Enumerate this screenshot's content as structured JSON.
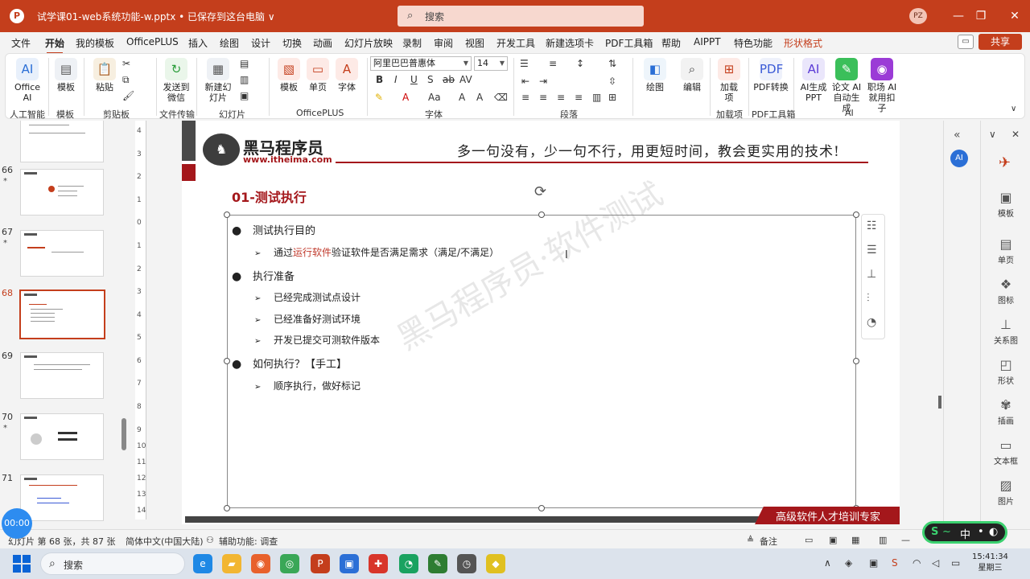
{
  "titlebar": {
    "doc_title": "试学课01-web系统功能-w.pptx • 已保存到这台电脑 ∨",
    "search_placeholder": "搜索",
    "user_initials": "PZ",
    "minimize": "—",
    "restore": "❐",
    "close": "✕"
  },
  "menu": {
    "tabs": [
      "文件",
      "开始",
      "我的模板",
      "OfficePLUS",
      "插入",
      "绘图",
      "设计",
      "切换",
      "动画",
      "幻灯片放映",
      "录制",
      "审阅",
      "视图",
      "开发工具",
      "新建选项卡",
      "PDF工具箱",
      "帮助",
      "AIPPT",
      "特色功能",
      "形状格式"
    ],
    "active": "开始",
    "share_label": "共享"
  },
  "ribbon": {
    "office_ai": "Office AI",
    "template": "模板",
    "paste": "粘贴",
    "send_wechat": "发送到微信",
    "new_slide": "新建幻灯片",
    "op_template": "模板",
    "single_page": "单页",
    "font_btn": "字体",
    "font_name": "阿里巴巴普惠体",
    "font_size": "14",
    "drawing": "绘图",
    "edit": "编辑",
    "addins": "加载项",
    "pdf_convert": "PDF转换",
    "ai_ppt": "AI生成PPT",
    "ai_paper": "论文 AI 自动生成",
    "ai_job": "职场 AI 就用扣子",
    "groups": {
      "ai": "人工智能",
      "template": "模板",
      "clipboard": "剪贴板",
      "file_transfer": "文件传输",
      "slides": "幻灯片",
      "officeplus": "OfficePLUS",
      "font": "字体",
      "paragraph": "段落",
      "addins": "加载项",
      "pdf": "PDF工具箱",
      "ai2": "AI"
    }
  },
  "thumbnails": {
    "numbers": [
      "66",
      "67",
      "68",
      "69",
      "70",
      "71"
    ],
    "current": "68"
  },
  "ruler": [
    "4",
    "3",
    "2",
    "1",
    "0",
    "1",
    "2",
    "3",
    "4",
    "5",
    "6",
    "7",
    "8",
    "9",
    "10",
    "11",
    "12",
    "13",
    "14"
  ],
  "slide": {
    "logo_text": "黑马程序员",
    "logo_url": "www.itheima.com",
    "slogan": "多一句没有，少一句不行，用更短时间，教会更实用的技术!",
    "title": "01-测试执行",
    "watermark": "黑马程序员·软件测试",
    "bullets": [
      {
        "text": "测试执行目的"
      },
      {
        "sub_prefix": "通过",
        "sub_highlight": "运行软件",
        "sub_suffix": "验证软件是否满足需求（满足/不满足）"
      },
      {
        "text": "执行准备"
      },
      {
        "sub": "已经完成测试点设计"
      },
      {
        "sub": "已经准备好测试环境"
      },
      {
        "sub": "开发已提交可测软件版本"
      },
      {
        "text": "如何执行？【手工】"
      },
      {
        "sub": "顺序执行，做好标记"
      }
    ],
    "footer": "高级软件人才培训专家"
  },
  "right_panel": {
    "items": [
      "模板",
      "单页",
      "图标",
      "关系图",
      "形状",
      "插画",
      "文本框",
      "图片"
    ]
  },
  "status": {
    "slide_info": "幻灯片 第 68 张，共 87 张",
    "language": "简体中文(中国大陆)",
    "accessibility": "辅助功能: 调查",
    "notes": "备注",
    "timer": "00:00",
    "ime": "中"
  },
  "taskbar": {
    "search": "搜索",
    "time": "15:41:34",
    "weekday": "星期三"
  }
}
